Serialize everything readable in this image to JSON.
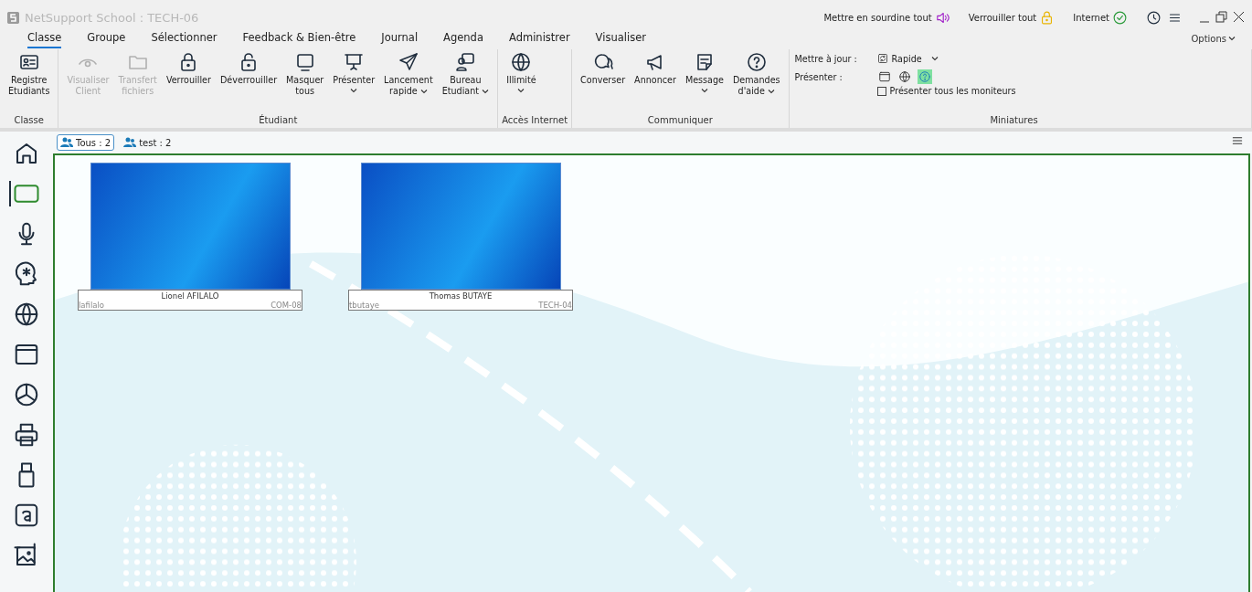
{
  "window": {
    "title": "NetSupport School : TECH-06"
  },
  "title_bar_actions": [
    {
      "label": "Mettre en sourdine tout"
    },
    {
      "label": "Verrouiller tout"
    },
    {
      "label": "Internet"
    }
  ],
  "options_label": "Options",
  "menu_tabs": [
    {
      "label": "Classe",
      "selected": true
    },
    {
      "label": "Groupe",
      "selected": false
    },
    {
      "label": "Sélectionner",
      "selected": false
    },
    {
      "label": "Feedback & Bien-être",
      "selected": false
    },
    {
      "label": "Journal",
      "selected": false
    },
    {
      "label": "Agenda",
      "selected": false
    },
    {
      "label": "Administrer",
      "selected": false
    },
    {
      "label": "Visualiser",
      "selected": false
    }
  ],
  "ribbon_groups": [
    {
      "label": "Classe",
      "buttons": [
        {
          "label": "Registre\nEtudiants",
          "disabled": false,
          "dropdown": false
        }
      ]
    },
    {
      "label": "Étudiant",
      "buttons": [
        {
          "label": "Visualiser\nClient",
          "disabled": true,
          "dropdown": false
        },
        {
          "label": "Transfert\nfichiers",
          "disabled": true,
          "dropdown": false
        },
        {
          "label": "Verrouiller",
          "disabled": false,
          "dropdown": false
        },
        {
          "label": "Déverrouiller",
          "disabled": false,
          "dropdown": false
        },
        {
          "label": "Masquer\ntous",
          "disabled": false,
          "dropdown": false
        },
        {
          "label": "Présenter",
          "disabled": false,
          "dropdown": true
        },
        {
          "label": "Lancement\nrapide",
          "disabled": false,
          "dropdown": true
        },
        {
          "label": "Bureau\nEtudiant",
          "disabled": false,
          "dropdown": true
        }
      ]
    },
    {
      "label": "Accès Internet",
      "buttons": [
        {
          "label": "Illimité",
          "disabled": false,
          "dropdown": true
        }
      ]
    },
    {
      "label": "Communiquer",
      "buttons": [
        {
          "label": "Converser",
          "disabled": false,
          "dropdown": false
        },
        {
          "label": "Annoncer",
          "disabled": false,
          "dropdown": false
        },
        {
          "label": "Message",
          "disabled": false,
          "dropdown": true
        },
        {
          "label": "Demandes\nd'aide",
          "disabled": false,
          "dropdown": true
        }
      ]
    }
  ],
  "miniatures": {
    "label": "Miniatures",
    "update_label": "Mettre à jour :",
    "update_value": "Rapide",
    "present_label": "Présenter :",
    "present_options": [
      {
        "selected": false
      },
      {
        "selected": false
      },
      {
        "selected": true
      }
    ],
    "all_monitors": {
      "label": "Présenter tous les moniteurs",
      "checked": false
    }
  },
  "sidebar": {
    "items": [
      {
        "selected": false
      },
      {
        "selected": true
      },
      {
        "selected": false
      },
      {
        "selected": false
      },
      {
        "selected": false
      },
      {
        "selected": false
      },
      {
        "selected": false
      },
      {
        "selected": false
      },
      {
        "selected": false
      },
      {
        "selected": false
      },
      {
        "selected": false
      }
    ]
  },
  "group_tabs": [
    {
      "label": "Tous : 2",
      "selected": true
    },
    {
      "label": "test : 2",
      "selected": false
    }
  ],
  "students": [
    {
      "name": "Lionel AFILALO",
      "user": "lafilalo",
      "machine": "COM-08"
    },
    {
      "name": "Thomas BUTAYE",
      "user": "tbutaye",
      "machine": "TECH-04"
    }
  ]
}
